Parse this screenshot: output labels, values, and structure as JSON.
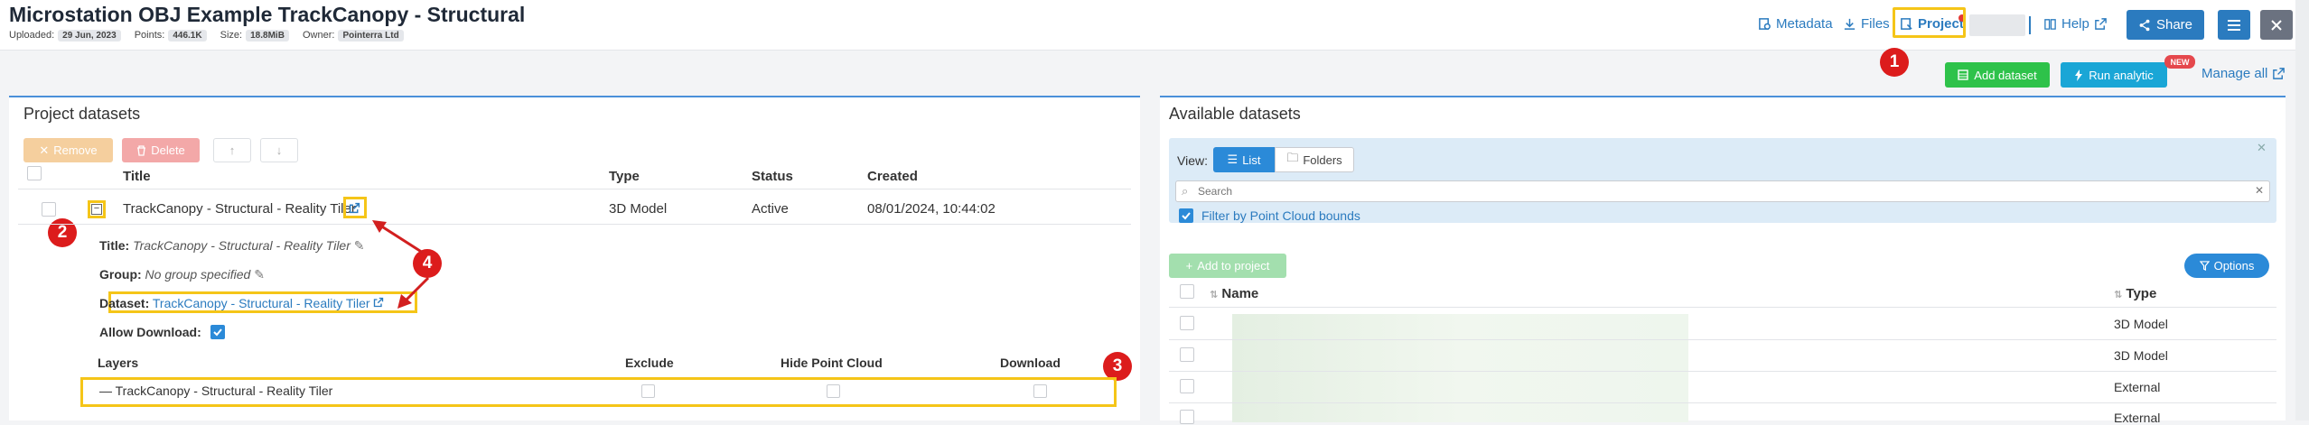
{
  "header": {
    "title": "Microstation OBJ Example TrackCanopy - Structural",
    "meta": [
      {
        "label": "Uploaded:",
        "value": "29 Jun, 2023"
      },
      {
        "label": "Points:",
        "value": "446.1K"
      },
      {
        "label": "Size:",
        "value": "18.8MiB"
      },
      {
        "label": "Owner:",
        "value": "Pointerra Ltd"
      }
    ],
    "nav": {
      "metadata": "Metadata",
      "files": "Files",
      "project": "Project",
      "help": "Help",
      "share": "Share"
    }
  },
  "toolbar": {
    "add_dataset": "Add dataset",
    "run_analytic": "Run analytic",
    "new_badge": "NEW",
    "manage_all": "Manage all"
  },
  "annotations": [
    "1",
    "2",
    "3",
    "4"
  ],
  "project_datasets": {
    "title": "Project datasets",
    "remove": "Remove",
    "delete": "Delete",
    "columns": [
      "Title",
      "Type",
      "Status",
      "Created"
    ],
    "row": {
      "title": "TrackCanopy - Structural - Reality Tiler",
      "type": "3D Model",
      "status": "Active",
      "created": "08/01/2024, 10:44:02"
    },
    "details": {
      "title_label": "Title:",
      "title_value": "TrackCanopy - Structural - Reality Tiler",
      "group_label": "Group:",
      "group_value": "No group specified",
      "dataset_label": "Dataset:",
      "dataset_value": "TrackCanopy - Structural - Reality Tiler",
      "allow_download_label": "Allow Download:"
    },
    "layers": {
      "columns": [
        "Layers",
        "Exclude",
        "Hide Point Cloud",
        "Download"
      ],
      "row_label": "TrackCanopy - Structural - Reality Tiler"
    }
  },
  "available_datasets": {
    "title": "Available datasets",
    "view_label": "View:",
    "list": "List",
    "folders": "Folders",
    "search_placeholder": "Search",
    "filter_label": "Filter by Point Cloud bounds",
    "add_to_project": "Add to project",
    "options": "Options",
    "columns": [
      "Name",
      "Type"
    ],
    "rows": [
      {
        "type": "3D Model"
      },
      {
        "type": "3D Model"
      },
      {
        "type": "External"
      },
      {
        "type": "External"
      }
    ]
  },
  "colors": {
    "accent": "#2b8ad8",
    "green": "#2ec24a",
    "cyan": "#1aa6d6",
    "highlight": "#f5c518",
    "annotation": "#dc1c1c"
  }
}
